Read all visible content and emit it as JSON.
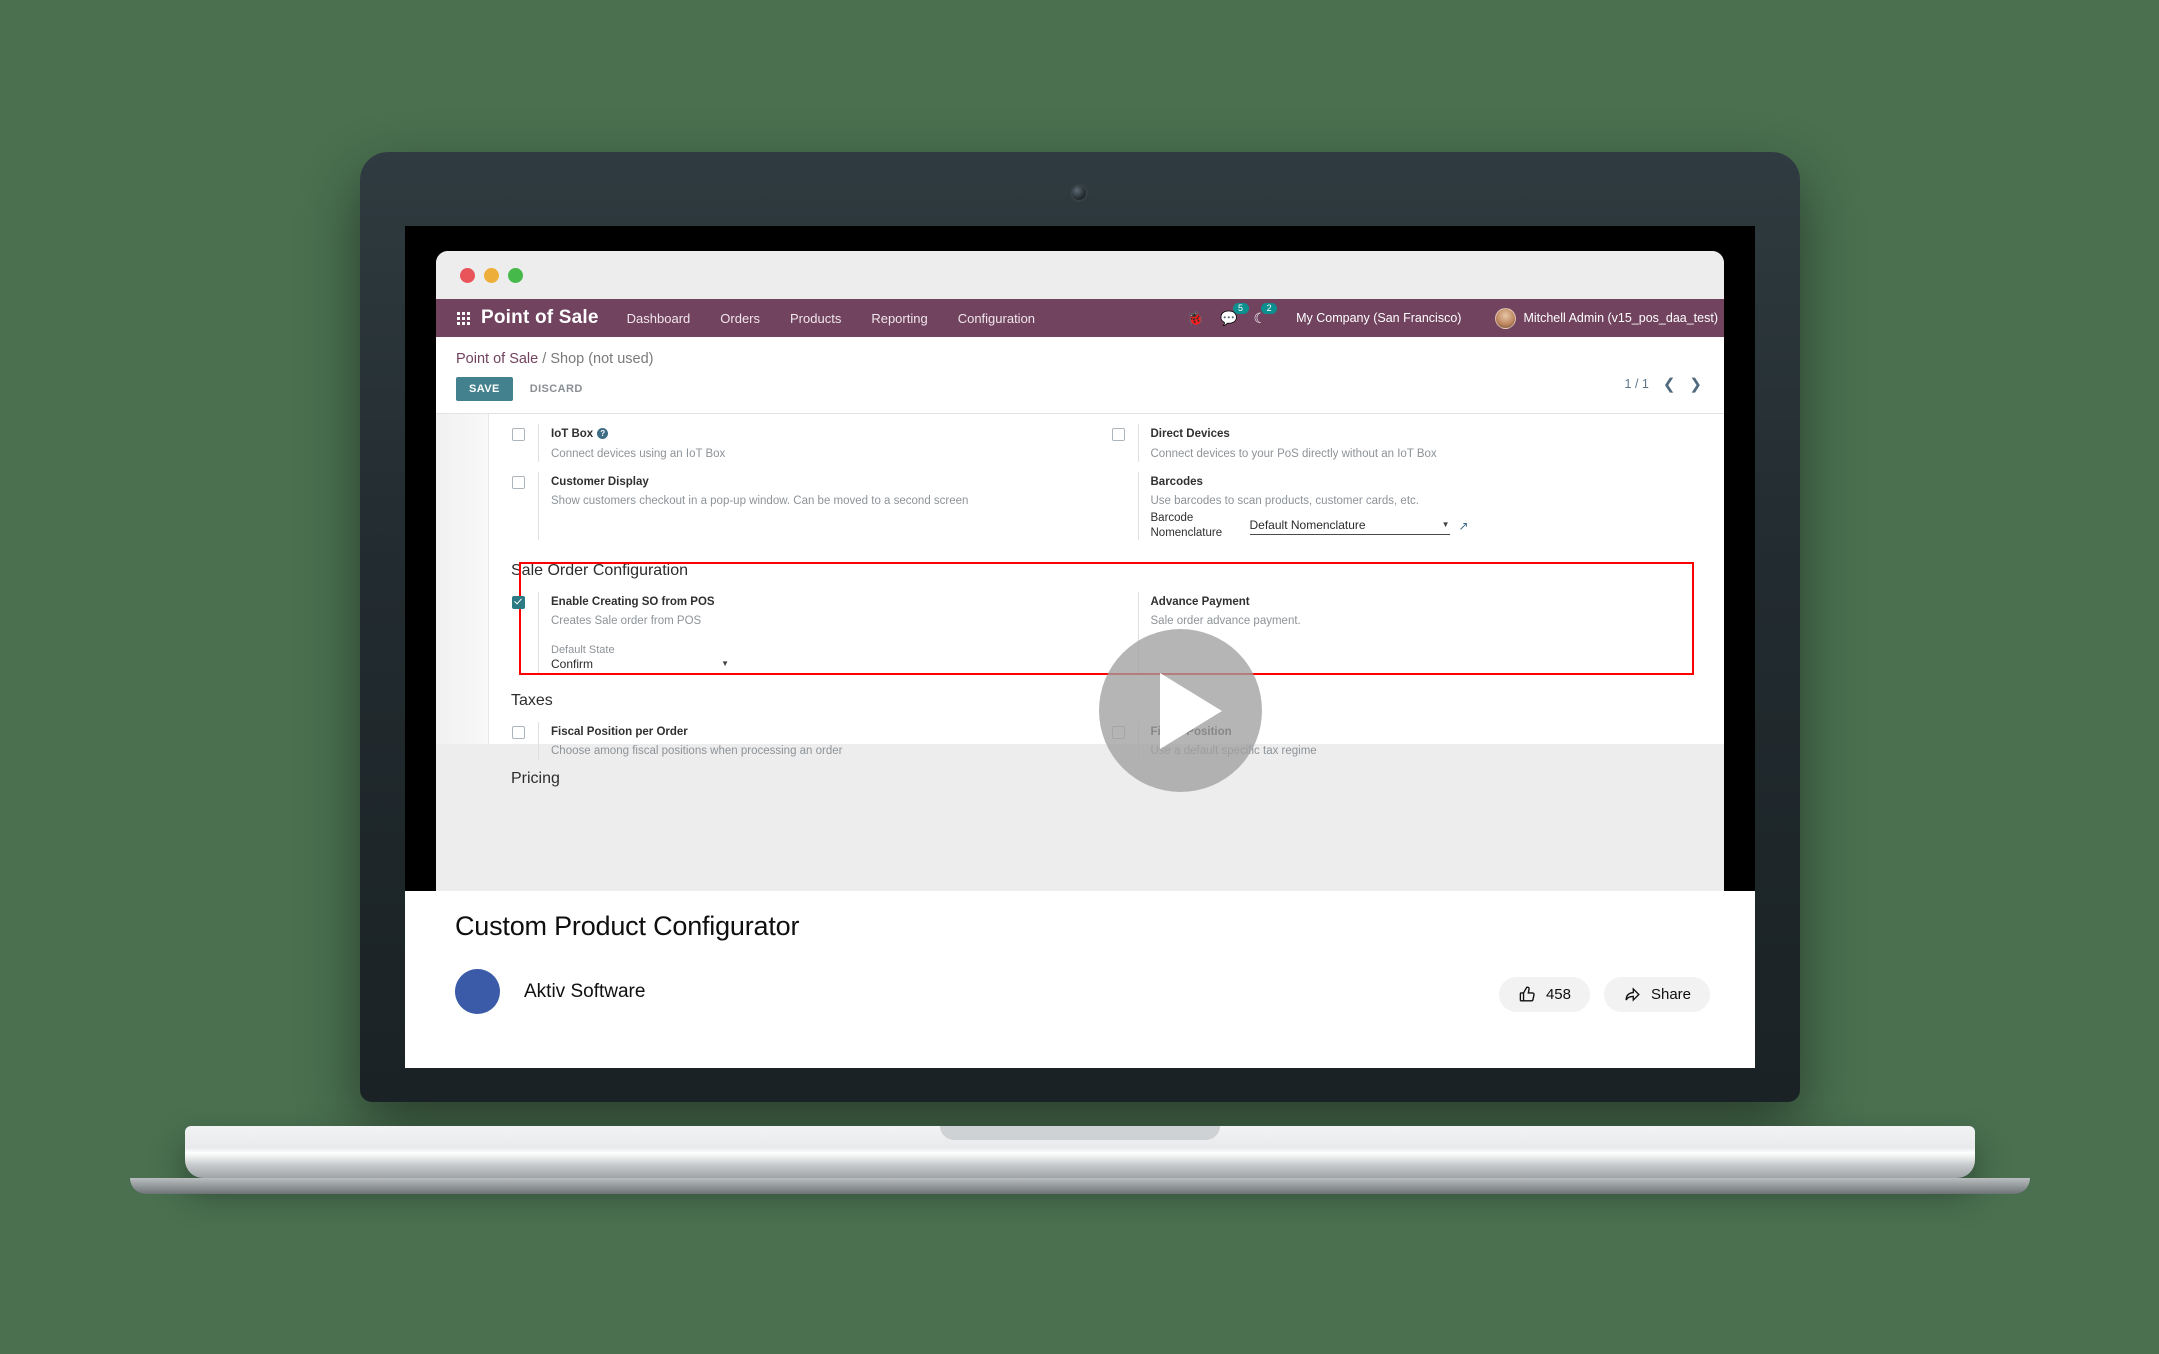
{
  "background_color": "#4a7050",
  "device": {
    "type": "laptop-mockup"
  },
  "browser": {
    "window_dots": [
      "close",
      "minimize",
      "maximize"
    ]
  },
  "odoo": {
    "app_name": "Point of Sale",
    "menu": [
      "Dashboard",
      "Orders",
      "Products",
      "Reporting",
      "Configuration"
    ],
    "systray": {
      "bug_icon": "bug-icon",
      "messages_icon": "messages-icon",
      "messages_count": "5",
      "activities_icon": "activities-clock-icon",
      "activities_count": "2",
      "company": "My Company (San Francisco)",
      "user": "Mitchell Admin (v15_pos_daa_test)"
    },
    "breadcrumb": {
      "root": "Point of Sale",
      "separator": " / ",
      "current": "Shop (not used)"
    },
    "control_panel": {
      "save": "SAVE",
      "discard": "DISCARD",
      "pager": "1 / 1",
      "prev_icon": "chevron-left-icon",
      "next_icon": "chevron-right-icon"
    },
    "settings": {
      "devices": [
        {
          "label": "IoT Box",
          "description": "Connect devices using an IoT Box",
          "checked": false,
          "has_help": true
        },
        {
          "label": "Direct Devices",
          "description": "Connect devices to your PoS directly without an IoT Box",
          "checked": false,
          "has_help": false
        },
        {
          "label": "Customer Display",
          "description": "Show customers checkout in a pop-up window. Can be moved to a second screen",
          "checked": false,
          "has_help": false
        },
        {
          "label": "Barcodes",
          "description": "Use barcodes to scan products, customer cards, etc.",
          "checked": null,
          "has_help": false
        }
      ],
      "barcode_nomenclature": {
        "label_line1": "Barcode",
        "label_line2": "Nomenclature",
        "value": "Default Nomenclature",
        "caret_icon": "chevron-down-icon",
        "external_link_icon": "external-link-icon"
      },
      "sale_order_section": {
        "title": "Sale Order Configuration",
        "highlighted": true,
        "highlight_color": "#ff0000",
        "enable_so": {
          "label": "Enable Creating SO from POS",
          "description": "Creates Sale order from POS",
          "checked": true
        },
        "advance_payment": {
          "label": "Advance Payment",
          "description": "Sale order advance payment."
        },
        "default_state": {
          "label": "Default State",
          "value": "Confirm",
          "caret_icon": "chevron-down-icon"
        }
      },
      "taxes_section": {
        "title": "Taxes",
        "items": [
          {
            "label": "Fiscal Position per Order",
            "description": "Choose among fiscal positions when processing an order",
            "checked": false
          },
          {
            "label": "Fiscal Position",
            "description": "Use a default specific tax regime",
            "checked": false
          }
        ]
      },
      "pricing_section": {
        "title": "Pricing"
      }
    }
  },
  "video": {
    "play_icon": "play-button-icon",
    "title": "Custom Product Configurator",
    "channel": "Aktiv Software",
    "like_icon": "thumbs-up-icon",
    "like_count": "458",
    "share_icon": "share-icon",
    "share_label": "Share"
  }
}
